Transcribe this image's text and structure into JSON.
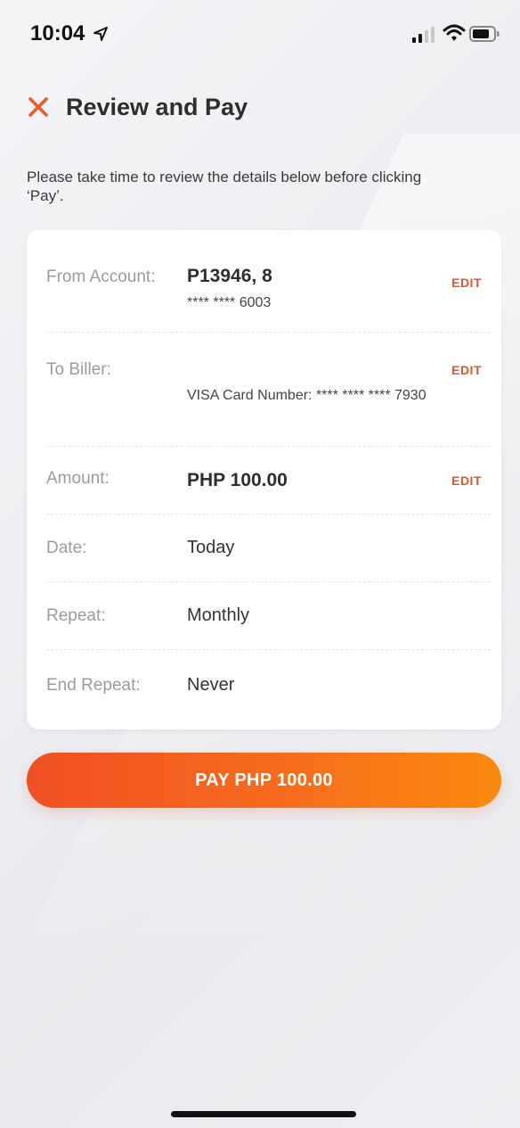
{
  "status_bar": {
    "time": "10:04"
  },
  "header": {
    "title": "Review and Pay"
  },
  "intro_text": "Please take time to review the details below before clicking ‘Pay’.",
  "details": {
    "from_account": {
      "label": "From Account:",
      "value": "P13946, 8",
      "sub": "**** **** 6003",
      "edit": "EDIT"
    },
    "to_biller": {
      "label": "To Biller:",
      "sub": "VISA Card Number: **** **** **** 7930",
      "edit": "EDIT"
    },
    "amount": {
      "label": "Amount:",
      "value": "PHP 100.00",
      "edit": "EDIT"
    },
    "date": {
      "label": "Date:",
      "value": "Today"
    },
    "repeat": {
      "label": "Repeat:",
      "value": "Monthly"
    },
    "end_repeat": {
      "label": "End Repeat:",
      "value": "Never"
    }
  },
  "pay_button": {
    "label": "PAY PHP 100.00"
  },
  "colors": {
    "accent": "#e1552a",
    "button_gradient_start": "#f04e23",
    "button_gradient_end": "#fb8a10"
  }
}
